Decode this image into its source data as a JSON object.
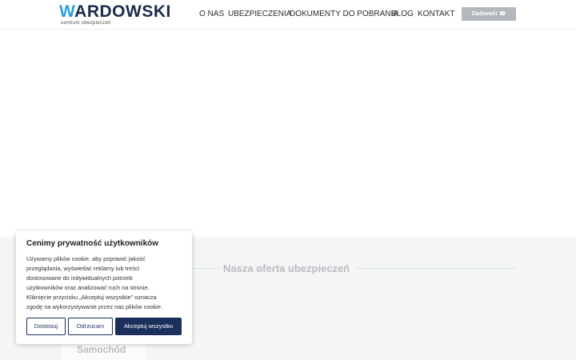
{
  "header": {
    "logo_main_first": "W",
    "logo_main_rest": "ARDOWSKI",
    "logo_sub": "centrum ubezpieczeń",
    "nav": [
      "O NAS",
      "UBEZPIECZENIA",
      "DOKUMENTY DO POBRANIA",
      "BLOG",
      "KONTAKT"
    ],
    "call_label": "Zadzwoń!",
    "call_icon": "phone-icon"
  },
  "offer": {
    "title": "Nasza oferta ubezpieczeń",
    "card_label": "Samochód"
  },
  "cookie": {
    "title": "Cenimy prywatność użytkowników",
    "text_lines": [
      "Używamy plików cookie, aby poprawić jakość",
      "przeglądania, wyświetlać reklamy lub treści",
      "dostosowane do indywidualnych potrzeb",
      "użytkowników oraz analizować ruch na stronie.",
      "Kliknięcie przycisku „Akceptuj wszystkie” oznacza",
      "zgodę na wykorzystywanie przez nas plików cookie."
    ],
    "btn_customize": "Dostosuj",
    "btn_reject": "Odrzucam",
    "btn_accept": "Akceptuj wszystko"
  },
  "colors": {
    "brand_dark": "#1b2a4a",
    "brand_accent": "#2a9fd8",
    "button_navy": "#1b2e5c"
  }
}
